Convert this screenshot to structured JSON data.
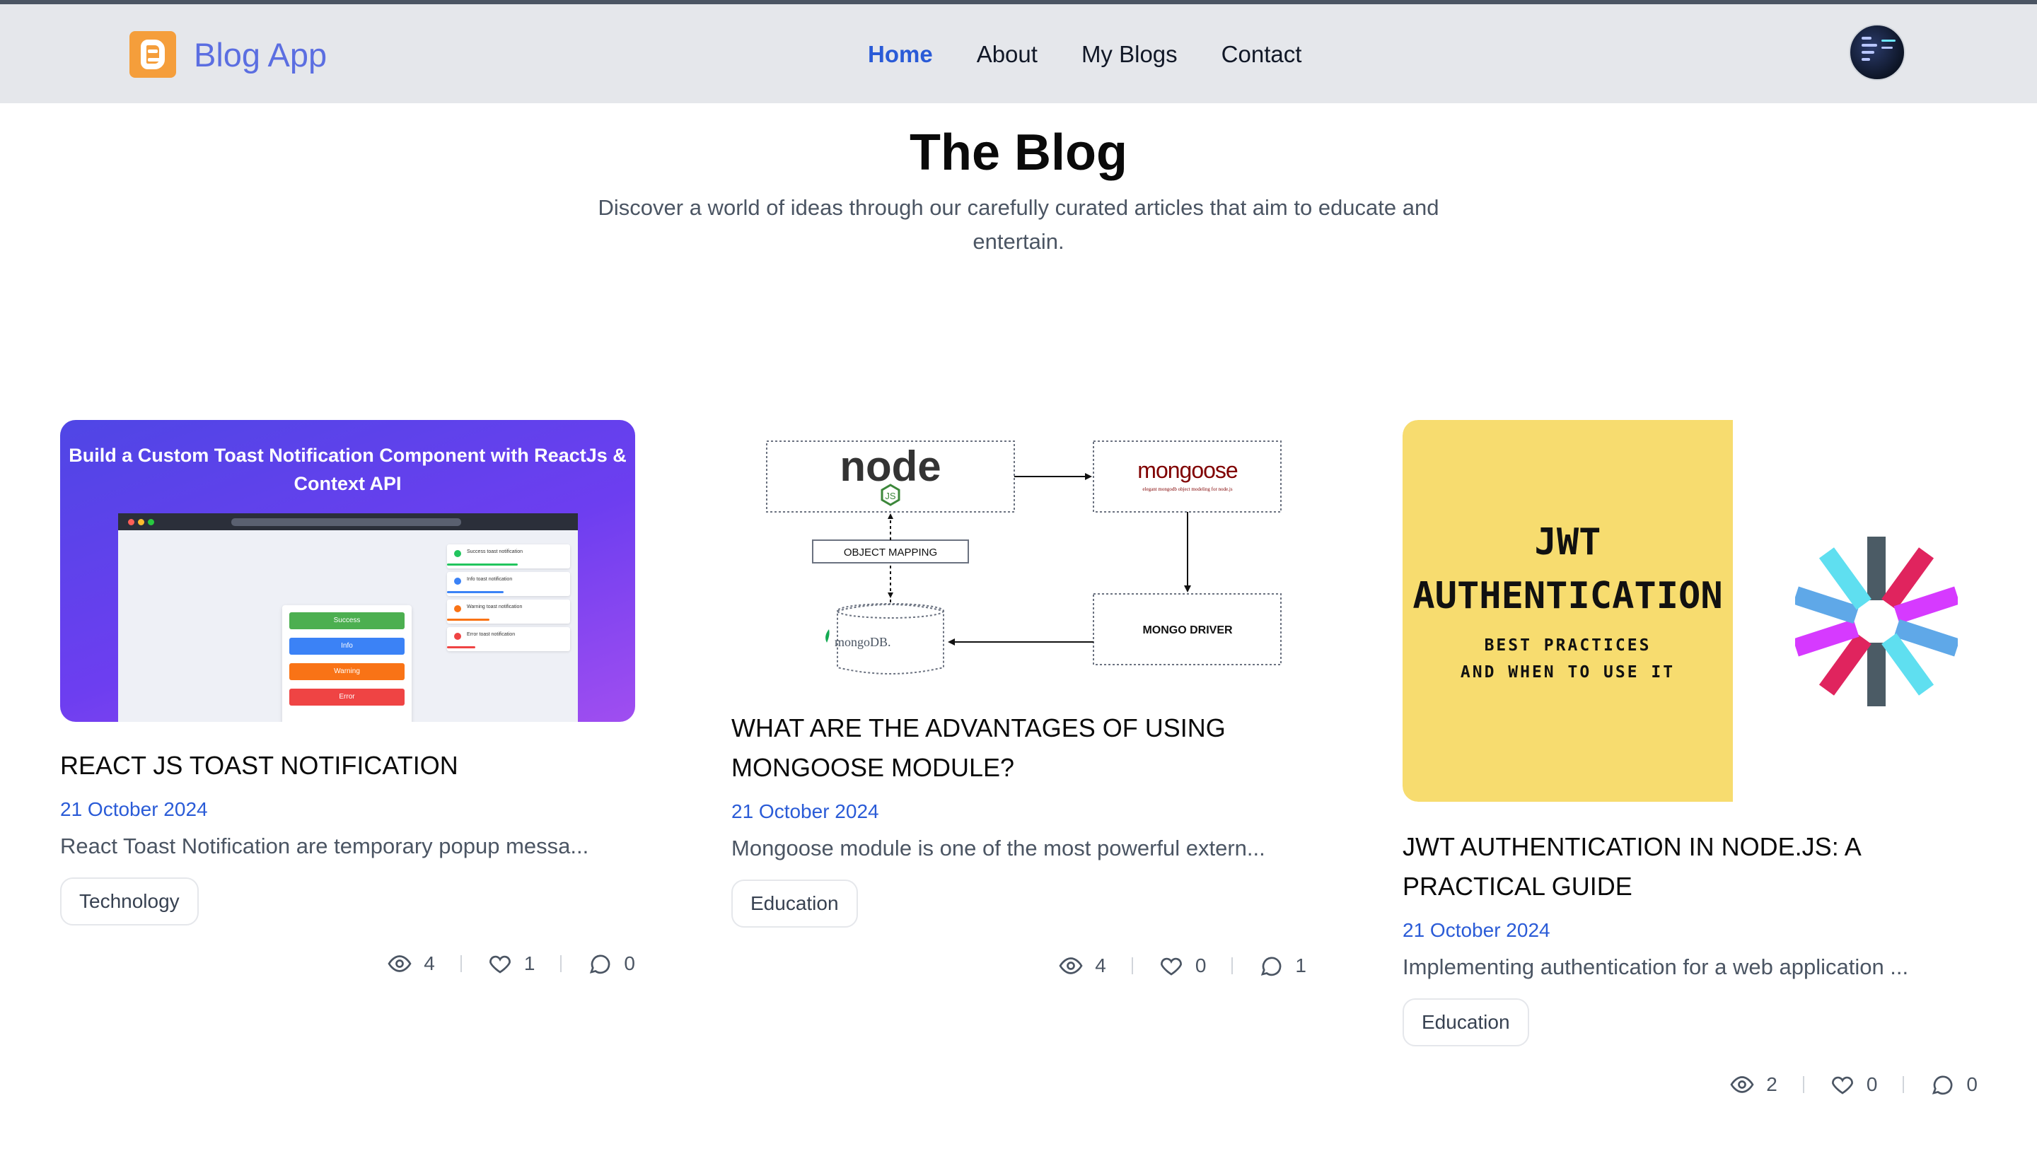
{
  "nav": {
    "brand": "Blog App",
    "links": [
      {
        "label": "Home",
        "active": true
      },
      {
        "label": "About",
        "active": false
      },
      {
        "label": "My Blogs",
        "active": false
      },
      {
        "label": "Contact",
        "active": false
      }
    ]
  },
  "hero": {
    "title": "The Blog",
    "subtitle": "Discover a world of ideas through our carefully curated articles that aim to educate and entertain."
  },
  "posts": [
    {
      "title": "REACT JS TOAST NOTIFICATION",
      "date": "21 October 2024",
      "excerpt": "React Toast Notification are temporary popup messa...",
      "tag": "Technology",
      "views": "4",
      "likes": "1",
      "comments": "0",
      "image": {
        "heading": "Build a Custom Toast Notification Component with ReactJs & Context API",
        "buttons": [
          "Success",
          "Info",
          "Warning",
          "Error"
        ],
        "toasts": [
          "Success toast notification",
          "Info toast notification",
          "Warning toast notification",
          "Error toast notification"
        ]
      }
    },
    {
      "title": "WHAT ARE THE ADVANTAGES OF USING MONGOOSE MODULE?",
      "date": "21 October 2024",
      "excerpt": "Mongoose module is one of the most powerful extern...",
      "tag": "Education",
      "views": "4",
      "likes": "0",
      "comments": "1",
      "image": {
        "node": "node",
        "node_sub": "JS",
        "mongoose": "mongoose",
        "mongoose_sub": "elegant mongodb object modeling for node.js",
        "mapping": "OBJECT MAPPING",
        "mongodb": "mongoDB.",
        "driver": "MONGO DRIVER"
      }
    },
    {
      "title": "JWT AUTHENTICATION IN NODE.JS: A PRACTICAL GUIDE",
      "date": "21 October 2024",
      "excerpt": "Implementing authentication for a web application ...",
      "tag": "Education",
      "views": "2",
      "likes": "0",
      "comments": "0",
      "image": {
        "line1": "JWT",
        "line2": "AUTHENTICATION",
        "line3": "BEST PRACTICES",
        "line4": "AND WHEN TO USE IT"
      }
    }
  ],
  "icons": {
    "brand": "blogger-logo-icon",
    "views": "eye-icon",
    "likes": "heart-icon",
    "comments": "comment-icon"
  },
  "colors": {
    "brand": "#5b6ee1",
    "brand_logo": "#f59e3b",
    "nav_active": "#2a5bd7",
    "date": "#2a5bd7",
    "navbar_bg": "#e5e7eb"
  }
}
